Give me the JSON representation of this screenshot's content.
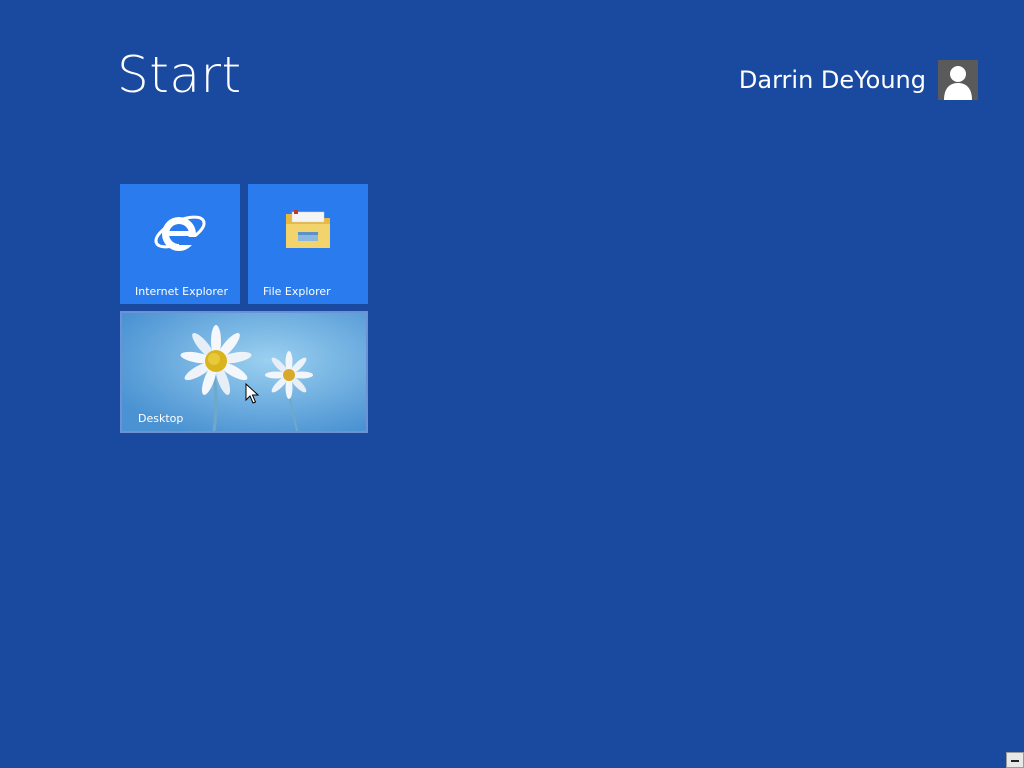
{
  "header": {
    "title": "Start",
    "user_name": "Darrin DeYoung",
    "avatar_icon": "user-silhouette-icon"
  },
  "tiles": [
    {
      "label": "Internet Explorer",
      "icon": "internet-explorer-icon",
      "color": "#2a7bee"
    },
    {
      "label": "File Explorer",
      "icon": "file-explorer-folder-icon",
      "color": "#2a7bee"
    },
    {
      "label": "Desktop",
      "icon": "desktop-wallpaper-daisies",
      "color": "#5ba6dd"
    }
  ],
  "colors": {
    "background": "#1a4aa0",
    "tile_blue": "#2a7bee"
  }
}
